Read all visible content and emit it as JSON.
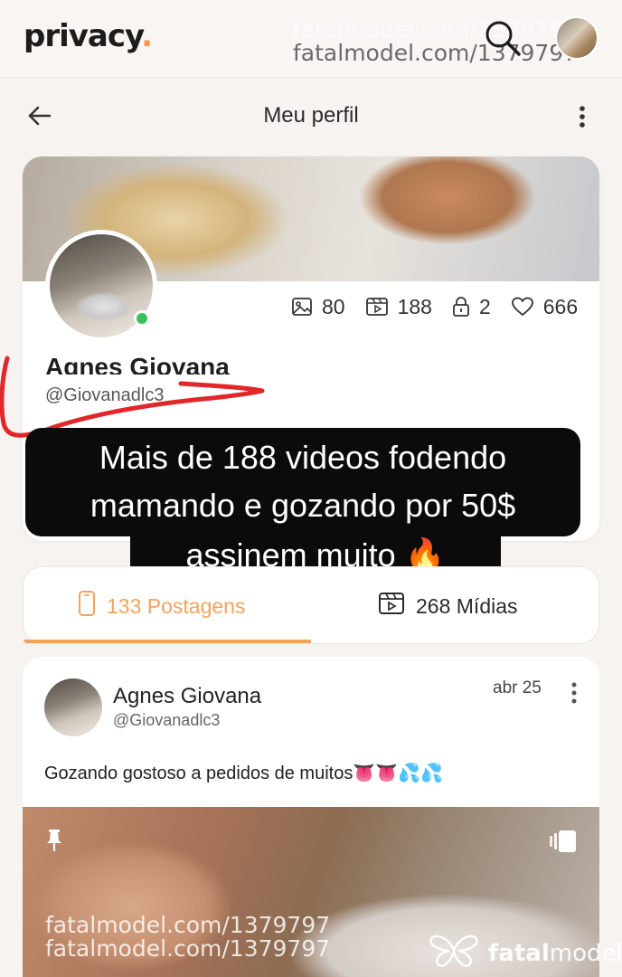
{
  "app": {
    "logo_text": "privacy",
    "logo_dot": "."
  },
  "watermark": {
    "top_text": "fatalmodel.com/1379797",
    "bottom_text": "fatalmodel.com/1379797",
    "brand_prefix": "fatal",
    "brand_suffix": "model"
  },
  "header": {
    "title": "Meu perfil"
  },
  "profile": {
    "name": "Agnes Giovana",
    "handle": "@Giovanadlc3",
    "stats": {
      "photos": "80",
      "videos": "188",
      "locked": "2",
      "likes": "666"
    },
    "online": true
  },
  "caption": {
    "line1": "Mais de 188 videos fodendo",
    "line2": "mamando e gozando por 50$",
    "line3": "assinem muito 🔥"
  },
  "tabs": {
    "posts": "133 Postagens",
    "media": "268 Mídias",
    "active": "posts"
  },
  "post": {
    "author": "Agnes Giovana",
    "handle": "@Giovanadlc3",
    "date": "abr 25",
    "text": "Gozando gostoso a pedidos de muitos👅👅💦💦"
  },
  "colors": {
    "accent": "#f3a25a",
    "online": "#3ac05a",
    "caption_bg": "#0b0b0b",
    "marker": "#e3262a"
  },
  "icons": {
    "search": "search-icon",
    "back": "arrow-left-icon",
    "more": "more-vertical-icon",
    "photos": "image-icon",
    "videos": "video-icon",
    "locked": "lock-icon",
    "likes": "heart-icon",
    "pin": "pin-icon",
    "gallery": "gallery-icon"
  }
}
